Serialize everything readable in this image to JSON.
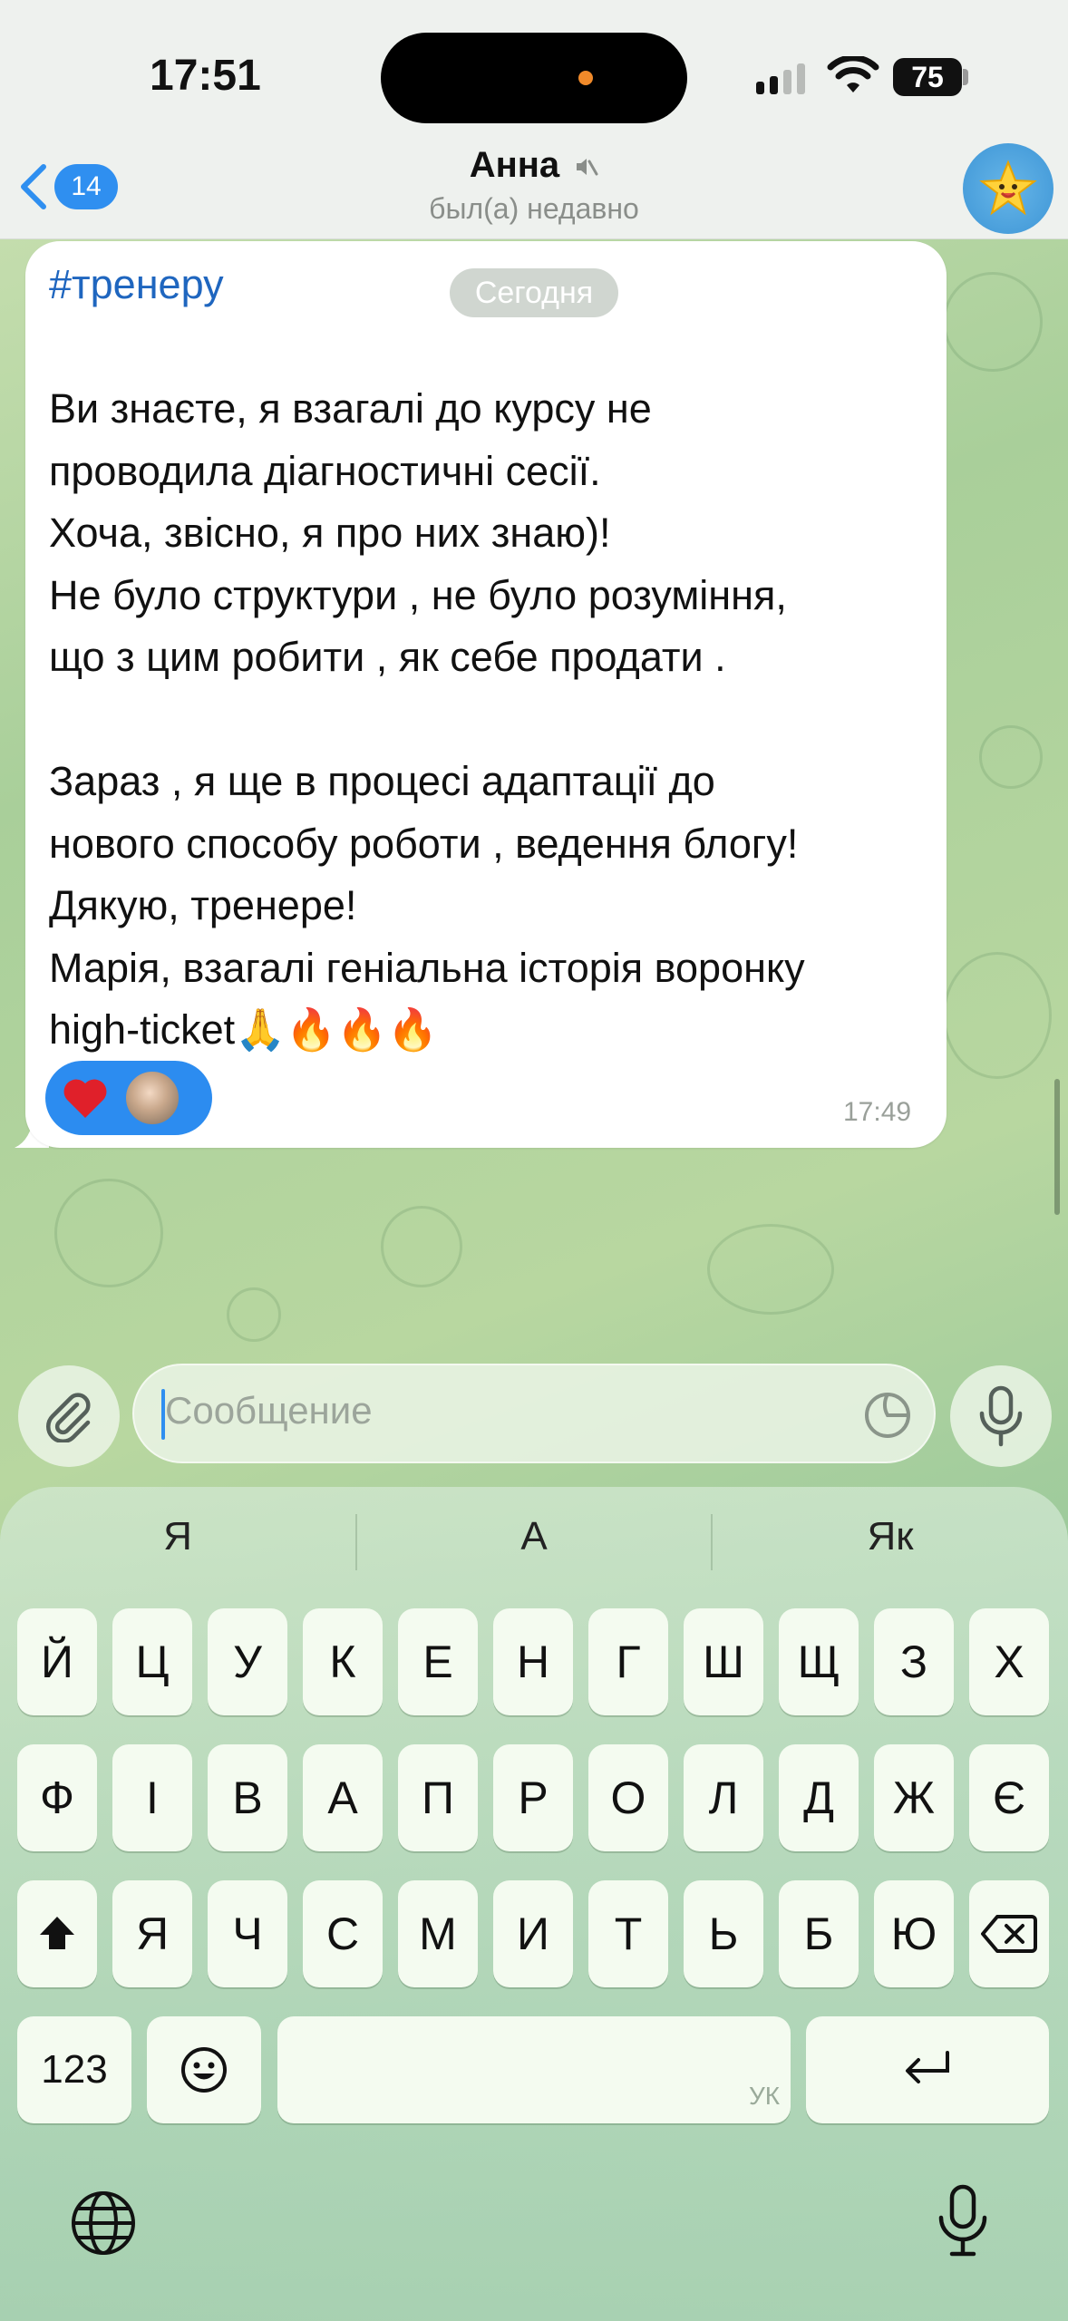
{
  "status_bar": {
    "time": "17:51",
    "battery": "75"
  },
  "header": {
    "back_count": "14",
    "title": "Анна",
    "subtitle": "был(а) недавно"
  },
  "message": {
    "hashtag": "#тренеру",
    "date_pill": "Сегодня",
    "body": "Ви знаєте, я взагалі до курсу не\nпроводила діагностичні сесії.\nХоча, звісно, я про них знаю)!\nНе було структури , не було розуміння,\nщо з цим робити , як себе продати .\n\nЗараз , я ще в процесі адаптації до\nнового способу роботи , ведення блогу!\nДякую, тренере!\nМарія, взагалі геніальна історія воронку\nhigh-ticket🙏🔥🔥🔥",
    "time": "17:49"
  },
  "composer": {
    "placeholder": "Сообщение"
  },
  "keyboard": {
    "suggestions": [
      "Я",
      "А",
      "Як"
    ],
    "row1": [
      "Й",
      "Ц",
      "У",
      "К",
      "Е",
      "Н",
      "Г",
      "Ш",
      "Щ",
      "З",
      "Х"
    ],
    "row2": [
      "Ф",
      "І",
      "В",
      "А",
      "П",
      "Р",
      "О",
      "Л",
      "Д",
      "Ж",
      "Є"
    ],
    "row3": [
      "Я",
      "Ч",
      "С",
      "М",
      "И",
      "Т",
      "Ь",
      "Б",
      "Ю"
    ],
    "numbers_label": "123",
    "space_lang": "УК"
  },
  "colors": {
    "accent": "#2f8ff0",
    "hashtag": "#1f66bf",
    "reaction_bg": "#2c8cf0",
    "heart": "#e0202a"
  }
}
